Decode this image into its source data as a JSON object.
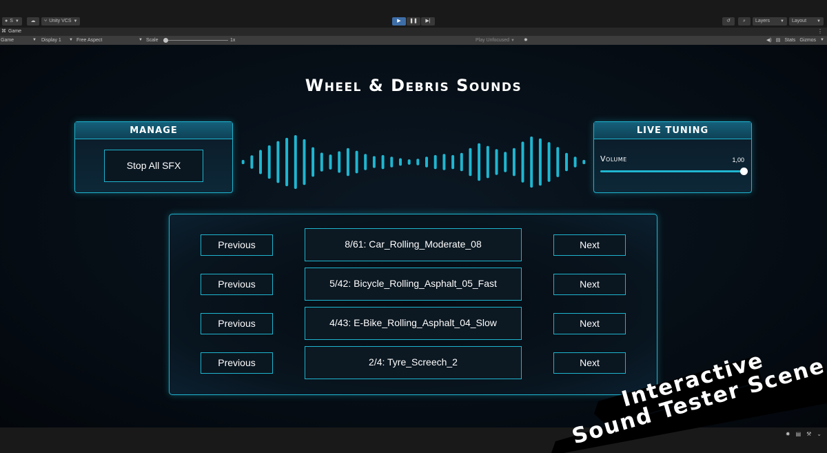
{
  "toolbar": {
    "account_label": "S",
    "cloud_icon": "cloud-icon",
    "vcs_label": "Unity VCS",
    "play_controls": [
      "play-icon",
      "pause-icon",
      "step-icon"
    ],
    "history_icon": "history-icon",
    "search_icon": "search-icon",
    "layers_label": "Layers",
    "layout_label": "Layout"
  },
  "tab": {
    "game_label": "Game"
  },
  "gamebar": {
    "view_label": "Game",
    "display_label": "Display 1",
    "aspect_label": "Free Aspect",
    "scale_label": "Scale",
    "scale_value": "1x",
    "play_mode_label": "Play Unfocused",
    "stats_label": "Stats",
    "gizmos_label": "Gizmos"
  },
  "game": {
    "title": "Wheel & Debris Sounds",
    "manage": {
      "header": "MANAGE",
      "stop_label": "Stop All SFX"
    },
    "tuning": {
      "header": "LIVE TUNING",
      "volume_label": "Volume",
      "volume_value": "1,00",
      "volume_fraction": 1.0
    },
    "waveform_bars": [
      0.08,
      0.25,
      0.45,
      0.62,
      0.78,
      0.9,
      1.0,
      0.85,
      0.55,
      0.35,
      0.28,
      0.4,
      0.52,
      0.42,
      0.3,
      0.22,
      0.26,
      0.2,
      0.14,
      0.1,
      0.12,
      0.2,
      0.26,
      0.3,
      0.26,
      0.34,
      0.52,
      0.7,
      0.6,
      0.48,
      0.38,
      0.52,
      0.76,
      0.95,
      0.88,
      0.74,
      0.56,
      0.34,
      0.2,
      0.08
    ],
    "accent_color": "#1fb6d0",
    "sounds": [
      {
        "prev_label": "Previous",
        "name": "8/61: Car_Rolling_Moderate_08",
        "next_label": "Next"
      },
      {
        "prev_label": "Previous",
        "name": "5/42: Bicycle_Rolling_Asphalt_05_Fast",
        "next_label": "Next"
      },
      {
        "prev_label": "Previous",
        "name": "4/43: E-Bike_Rolling_Asphalt_04_Slow",
        "next_label": "Next"
      },
      {
        "prev_label": "Previous",
        "name": "2/4: Tyre_Screech_2",
        "next_label": "Next"
      }
    ]
  },
  "banner": {
    "line1": "Interactive",
    "line2": "Sound Tester Scene",
    "color": "#000000"
  }
}
